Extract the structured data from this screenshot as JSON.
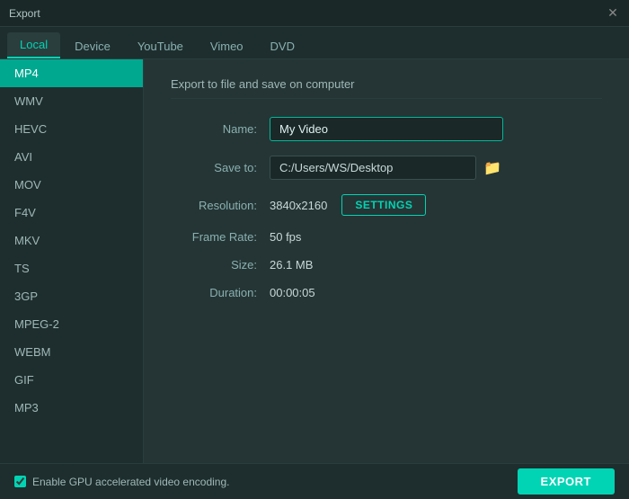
{
  "titlebar": {
    "title": "Export",
    "close_label": "✕"
  },
  "tabs": [
    {
      "id": "local",
      "label": "Local",
      "active": true
    },
    {
      "id": "device",
      "label": "Device",
      "active": false
    },
    {
      "id": "youtube",
      "label": "YouTube",
      "active": false
    },
    {
      "id": "vimeo",
      "label": "Vimeo",
      "active": false
    },
    {
      "id": "dvd",
      "label": "DVD",
      "active": false
    }
  ],
  "sidebar": {
    "items": [
      {
        "id": "mp4",
        "label": "MP4",
        "active": true
      },
      {
        "id": "wmv",
        "label": "WMV",
        "active": false
      },
      {
        "id": "hevc",
        "label": "HEVC",
        "active": false
      },
      {
        "id": "avi",
        "label": "AVI",
        "active": false
      },
      {
        "id": "mov",
        "label": "MOV",
        "active": false
      },
      {
        "id": "f4v",
        "label": "F4V",
        "active": false
      },
      {
        "id": "mkv",
        "label": "MKV",
        "active": false
      },
      {
        "id": "ts",
        "label": "TS",
        "active": false
      },
      {
        "id": "3gp",
        "label": "3GP",
        "active": false
      },
      {
        "id": "mpeg2",
        "label": "MPEG-2",
        "active": false
      },
      {
        "id": "webm",
        "label": "WEBM",
        "active": false
      },
      {
        "id": "gif",
        "label": "GIF",
        "active": false
      },
      {
        "id": "mp3",
        "label": "MP3",
        "active": false
      }
    ]
  },
  "content": {
    "section_title": "Export to file and save on computer",
    "name_label": "Name:",
    "name_value": "My Video",
    "save_to_label": "Save to:",
    "save_to_value": "C:/Users/WS/Desktop",
    "folder_icon": "📁",
    "resolution_label": "Resolution:",
    "resolution_value": "3840x2160",
    "settings_label": "SETTINGS",
    "frame_rate_label": "Frame Rate:",
    "frame_rate_value": "50 fps",
    "size_label": "Size:",
    "size_value": "26.1 MB",
    "duration_label": "Duration:",
    "duration_value": "00:00:05"
  },
  "bottom": {
    "gpu_label": "Enable GPU accelerated video encoding.",
    "export_label": "EXPORT"
  }
}
